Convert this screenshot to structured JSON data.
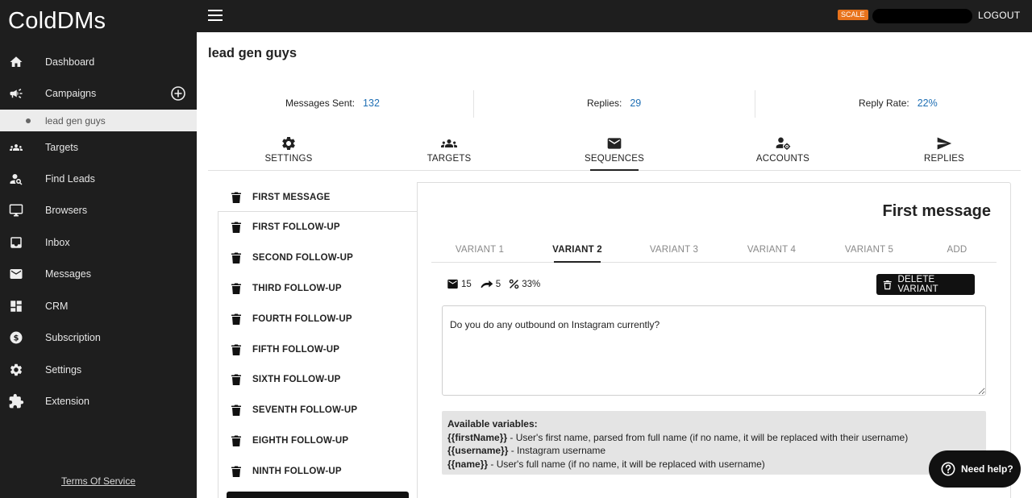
{
  "brand": "ColdDMs",
  "sidebar": {
    "items": [
      {
        "label": "Dashboard",
        "icon": "home-icon"
      },
      {
        "label": "Campaigns",
        "icon": "megaphone-icon"
      },
      {
        "label": "Targets",
        "icon": "group-icon"
      },
      {
        "label": "Find Leads",
        "icon": "person-search-icon"
      },
      {
        "label": "Browsers",
        "icon": "monitor-icon"
      },
      {
        "label": "Inbox",
        "icon": "inbox-icon"
      },
      {
        "label": "Messages",
        "icon": "mail-icon"
      },
      {
        "label": "CRM",
        "icon": "dashboard-grid-icon"
      },
      {
        "label": "Subscription",
        "icon": "dollar-icon"
      },
      {
        "label": "Settings",
        "icon": "gear-icon"
      },
      {
        "label": "Extension",
        "icon": "puzzle-icon"
      }
    ],
    "active_sub_item": "lead gen guys",
    "terms": "Terms Of Service"
  },
  "topbar": {
    "plan_badge": "SCALE",
    "logout": "LOGOUT"
  },
  "campaign": {
    "title": "lead gen guys",
    "stats": {
      "messages_sent_label": "Messages Sent:",
      "messages_sent": "132",
      "replies_label": "Replies:",
      "replies": "29",
      "reply_rate_label": "Reply Rate:",
      "reply_rate": "22%"
    },
    "tabs": [
      {
        "label": "SETTINGS",
        "icon": "gear-icon"
      },
      {
        "label": "TARGETS",
        "icon": "group-icon"
      },
      {
        "label": "SEQUENCES",
        "icon": "mail-icon"
      },
      {
        "label": "ACCOUNTS",
        "icon": "account-settings-icon"
      },
      {
        "label": "REPLIES",
        "icon": "send-icon"
      }
    ],
    "active_tab": "SEQUENCES"
  },
  "sequences": [
    "FIRST MESSAGE",
    "FIRST FOLLOW-UP",
    "SECOND FOLLOW-UP",
    "THIRD FOLLOW-UP",
    "FOURTH FOLLOW-UP",
    "FIFTH FOLLOW-UP",
    "SIXTH FOLLOW-UP",
    "SEVENTH FOLLOW-UP",
    "EIGHTH FOLLOW-UP",
    "NINTH FOLLOW-UP"
  ],
  "editor": {
    "title": "First message",
    "variant_tabs": [
      "VARIANT 1",
      "VARIANT 2",
      "VARIANT 3",
      "VARIANT 4",
      "VARIANT 5",
      "ADD"
    ],
    "active_variant": "VARIANT 2",
    "metrics": {
      "sent": "15",
      "replies": "5",
      "rate": "33%"
    },
    "delete_label": "DELETE VARIANT",
    "message": "Do you do any outbound on Instagram currently?",
    "variables": {
      "heading": "Available variables:",
      "items": [
        {
          "token": "{{firstName}}",
          "desc": " - User's first name, parsed from full name (if no name, it will be replaced with their username)"
        },
        {
          "token": "{{username}}",
          "desc": " - Instagram username"
        },
        {
          "token": "{{name}}",
          "desc": " - User's full name (if no name, it will be replaced with username)"
        }
      ]
    }
  },
  "help": {
    "label": "Need help?"
  },
  "colors": {
    "sidebar_bg": "#1e1e1e",
    "accent_blue": "#1f6fb4",
    "badge_orange": "#e8731c"
  }
}
